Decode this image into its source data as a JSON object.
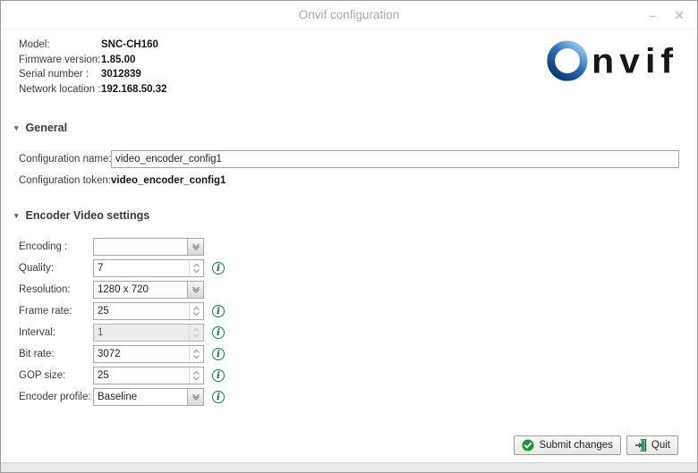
{
  "window": {
    "title": "Onvif configuration",
    "minimize_glyph": "–",
    "close_glyph": "✕"
  },
  "device_info": {
    "rows": [
      {
        "label": "Model:",
        "value": "SNC-CH160"
      },
      {
        "label": "Firmware version:",
        "value": "1.85.00"
      },
      {
        "label": "Serial number :",
        "value": "3012839"
      },
      {
        "label": "Network location :",
        "value": "192.168.50.32"
      }
    ]
  },
  "logo": {
    "wordmark": "nvif",
    "ring_icon": "onvif-ring-icon"
  },
  "general": {
    "collapse_glyph": "▾",
    "header": "General",
    "name_label": "Configuration name:",
    "name_value": "video_encoder_config1",
    "token_label": "Configuration token:",
    "token_value": "video_encoder_config1"
  },
  "encoder": {
    "collapse_glyph": "▾",
    "header": "Encoder Video settings",
    "info_glyph": "i",
    "fields": [
      {
        "label": "Encoding :",
        "value": "",
        "control": "dropdown",
        "info": false,
        "disabled": false
      },
      {
        "label": "Quality:",
        "value": "7",
        "control": "spinner",
        "info": true,
        "disabled": false
      },
      {
        "label": "Resolution:",
        "value": "1280 x 720",
        "control": "dropdown",
        "info": false,
        "disabled": false
      },
      {
        "label": "Frame rate:",
        "value": "25",
        "control": "spinner",
        "info": true,
        "disabled": false
      },
      {
        "label": "Interval:",
        "value": "1",
        "control": "spinner",
        "info": true,
        "disabled": true
      },
      {
        "label": "Bit rate:",
        "value": "3072",
        "control": "spinner",
        "info": true,
        "disabled": false
      },
      {
        "label": "GOP size:",
        "value": "25",
        "control": "spinner",
        "info": true,
        "disabled": false
      },
      {
        "label": "Encoder profile:",
        "value": "Baseline",
        "control": "dropdown",
        "info": true,
        "disabled": false
      }
    ]
  },
  "buttons": {
    "submit": "Submit changes",
    "quit": "Quit"
  },
  "colors": {
    "info_green": "#0f7a50",
    "check_green": "#1d9440",
    "quit_door_green": "#2f9e44",
    "logo_blue_dark": "#0d3a74",
    "logo_blue_light": "#8ec0e8",
    "title_gray": "#a8a8a8"
  }
}
